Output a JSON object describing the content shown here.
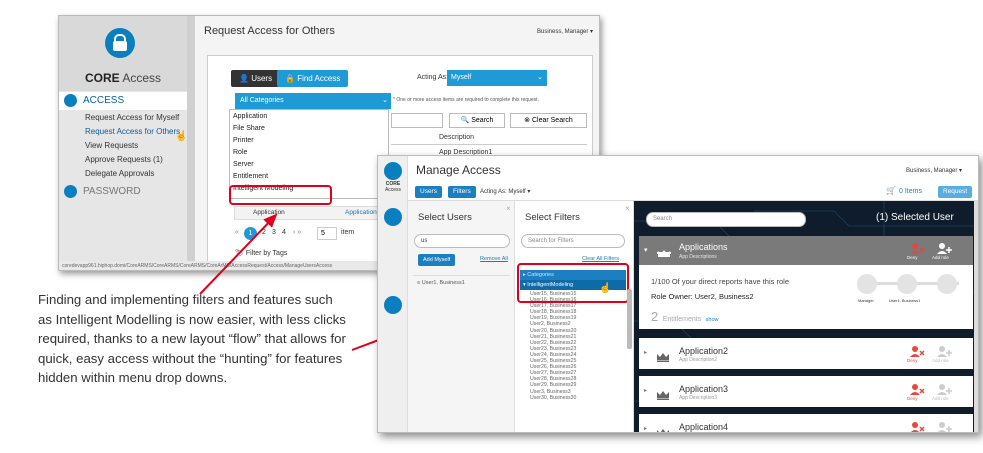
{
  "old_screen": {
    "brand_bold": "CORE",
    "brand_rest": " Access",
    "nav": {
      "access_header": "ACCESS",
      "items": [
        "Request Access for Myself",
        "Request Access for Others",
        "View Requests",
        "Approve Requests (1)",
        "Delegate Approvals"
      ],
      "password_header": "PASSWORD"
    },
    "page_title": "Request Access for Others",
    "user_menu": "Business, Manager ▾",
    "users_button": "Users",
    "find_access_button": "Find Access",
    "acting_as_label": "Acting As:",
    "acting_as_value": "Myself",
    "category_select": "All Categories",
    "required_note": "* One or more access items are required to complete this request.",
    "categories": [
      "Application",
      "File Share",
      "Printer",
      "Role",
      "Server",
      "Entitlement",
      "Intelligent Modeling"
    ],
    "search_button": "Search",
    "clear_search_button": "Clear Search",
    "description_header": "Description",
    "app_description": "App Description1",
    "application_header": "Application",
    "application_header_2": "Application",
    "pages": [
      "1",
      "2",
      "3",
      "4"
    ],
    "page_size": "5",
    "items_label": "item",
    "filter_by_tags": "Filter by Tags",
    "status_url": "coredevapp961.hiphop.domi/CoreARMS/CoreARMS/CoreARMS/CoreArMS/AccessRequest/Access/ManageUsersAccess"
  },
  "annotation": "Finding and implementing filters and features such as Intelligent Modelling is now easier, with less clicks required, thanks to a new layout “flow” that allows for quick, easy access without the “hunting” for features hidden within menu drop downs.",
  "new_screen": {
    "rail_brand_1": "CORE",
    "rail_brand_2": "Access",
    "page_title": "Manage Access",
    "user_menu": "Business, Manager ▾",
    "users_tab": "Users",
    "filters_tab": "Filters",
    "acting_as": "Acting As: Myself ▾",
    "cart": "0 Items",
    "request_button": "Request",
    "select_users": {
      "title": "Select Users",
      "search_value": "us",
      "add_myself": "Add Myself",
      "remove_all": "Remove All",
      "selected": "User1, Business1"
    },
    "select_filters": {
      "title": "Select Filters",
      "search_placeholder": "Search for Filters",
      "clear_all": "Clear All Filters",
      "categories_node": "Categories",
      "im_node": "IntelligentModeling",
      "users": [
        "User15, Business15",
        "User16, Business16",
        "User17, Business17",
        "User18, Business18",
        "User19, Business19",
        "User2, Business2",
        "User20, Business20",
        "User21, Business21",
        "User22, Business22",
        "User23, Business23",
        "User24, Business24",
        "User25, Business25",
        "User26, Business26",
        "User27, Business27",
        "User28, Business28",
        "User29, Business29",
        "User3, Business3",
        "User30, Business30"
      ]
    },
    "results": {
      "search_placeholder": "Search",
      "selected_count": "(1) Selected User",
      "deny": "Deny",
      "add_role": "Add role",
      "app1": {
        "name": "Applications",
        "desc": "App Descriptions",
        "reports_text": "1/100 Of your direct reports have this role",
        "role_owner": "Role Owner: User2, Business2",
        "entitlements_count": "2",
        "entitlements_label": "Entitlements",
        "show_link": "show",
        "step_manager": "Manager",
        "step_user": "User1, Business1"
      },
      "app2": {
        "name": "Application2",
        "desc": "App Description2"
      },
      "app3": {
        "name": "Application3",
        "desc": "App Description3"
      },
      "app4": {
        "name": "Application4"
      }
    }
  },
  "colors": {
    "accent_blue": "#1b7fc1",
    "highlight_red": "#e0001b",
    "deny_red": "#e8473f",
    "dark_panel": "#0e1c2c"
  }
}
